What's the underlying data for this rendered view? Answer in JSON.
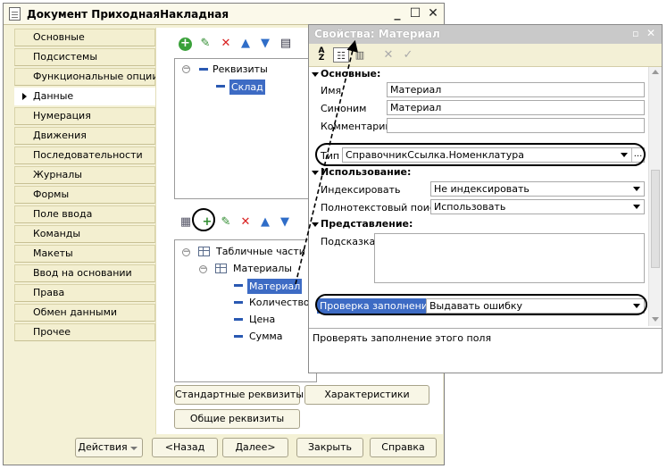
{
  "main_window": {
    "title": "Документ ПриходнаяНакладная",
    "controls": {
      "minimize": "_",
      "maximize": "☐",
      "close": "✕"
    }
  },
  "nav": {
    "items": [
      {
        "label": "Основные"
      },
      {
        "label": "Подсистемы"
      },
      {
        "label": "Функциональные опции"
      },
      {
        "label": "Данные",
        "active": true
      },
      {
        "label": "Нумерация"
      },
      {
        "label": "Движения"
      },
      {
        "label": "Последовательности"
      },
      {
        "label": "Журналы"
      },
      {
        "label": "Формы"
      },
      {
        "label": "Поле ввода"
      },
      {
        "label": "Команды"
      },
      {
        "label": "Макеты"
      },
      {
        "label": "Ввод на основании"
      },
      {
        "label": "Права"
      },
      {
        "label": "Обмен данными"
      },
      {
        "label": "Прочее"
      }
    ]
  },
  "attributes_panel": {
    "toolbar_icons": [
      "add-icon",
      "pencil-icon",
      "delete-icon",
      "arrow-up-icon",
      "arrow-down-icon",
      "list-icon"
    ],
    "root": "Реквизиты",
    "items": [
      "Склад"
    ]
  },
  "tabular_panel": {
    "toolbar_icons": [
      "table-add-icon",
      "add-attribute-icon",
      "pencil-icon",
      "delete-icon",
      "arrow-up-icon",
      "arrow-down-icon"
    ],
    "root": "Табличные части",
    "table": "Материалы",
    "attributes": [
      "Материал",
      "Количество",
      "Цена",
      "Сумма"
    ]
  },
  "panel_buttons": {
    "standard": "Стандартные реквизиты",
    "characteristics": "Характеристики",
    "common": "Общие реквизиты"
  },
  "bottom_buttons": {
    "actions": "Действия",
    "back": "<Назад",
    "next": "Далее>",
    "close": "Закрыть",
    "help": "Справка"
  },
  "properties": {
    "title": "Свойства: Материал",
    "pin": "▫",
    "close": "✕",
    "sections": {
      "main": "Основные:",
      "usage": "Использование:",
      "presentation": "Представление:"
    },
    "labels": {
      "name": "Имя",
      "synonym": "Синоним",
      "comment": "Комментарий",
      "type": "Тип",
      "index": "Индексировать",
      "fulltext": "Полнотекстовый поиск",
      "hint": "Подсказка",
      "fill_check": "Проверка заполнения"
    },
    "values": {
      "name": "Материал",
      "synonym": "Материал",
      "comment": "",
      "type": "СправочникСсылка.Номенклатура",
      "index": "Не индексировать",
      "fulltext": "Использовать",
      "hint": "",
      "fill_check": "Выдавать ошибку"
    },
    "ellipsis": "...",
    "description": "Проверять заполнение этого поля"
  },
  "colors": {
    "window_bg": "#f4f1d6",
    "selection": "#3d6bc4"
  }
}
